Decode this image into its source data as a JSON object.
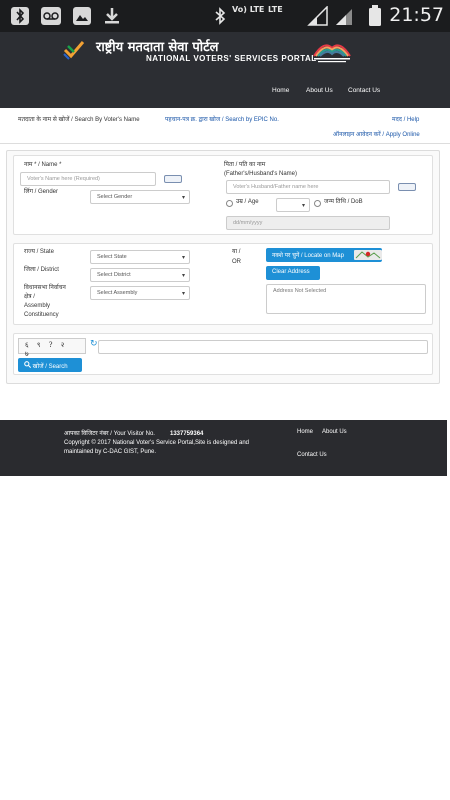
{
  "status_bar": {
    "time": "21:57",
    "network_label": "Vo) LTE",
    "lte_label": "LTE"
  },
  "header": {
    "title_hindi": "राष्ट्रीय मतदाता सेवा पोर्टल",
    "title_english": "NATIONAL VOTERS' SERVICES PORTAL",
    "nav": [
      "Home",
      "About Us",
      "Contact Us"
    ]
  },
  "mode_bar": {
    "search_by_name": "मतदाता के नाम से खोजें / Search By Voter's Name",
    "search_by_epic": "पहचान-पत्र क्र. द्वारा खोज / Search by EPIC No.",
    "help": "मदद / Help",
    "apply_online": "ऑनलाइन आवेदन करें / Apply Online"
  },
  "form": {
    "name_label": "नाम * / Name *",
    "name_placeholder": "Voter's Name here (Required)",
    "relative_label_1": "पिता / पति का नाम",
    "relative_label_2": "(Father's/Husband's Name)",
    "relative_placeholder": "Voter's Husband/Father name here",
    "gender_label": "लिंग / Gender",
    "gender_value": "Select Gender",
    "age_label": "उम्र / Age",
    "dob_label": "जन्म तिथि / DoB",
    "dob_placeholder": "dd/mm/yyyy",
    "state_label": "राज्य / State",
    "state_value": "Select State",
    "district_label": "जिला / District",
    "district_value": "Select District",
    "assembly_label_1": "विधानसभा निर्वाचन",
    "assembly_label_2": "क्षेत्र /",
    "assembly_label_3": "Assembly",
    "assembly_label_4": "Constituency",
    "assembly_value": "Select Assembly",
    "or_label_1": "या /",
    "or_label_2": "OR",
    "locate_button": "नक्शे पर चुनें / Locate on Map",
    "clear_button": "Clear Address",
    "address_placeholder": "Address Not Selected",
    "captcha_text": "६ ९ ? २ ७",
    "search_button": "खोजें / Search"
  },
  "footer": {
    "visitor_label": "आपका विजिटर नंबर / Your Visitor No.",
    "visitor_number": "1337759364",
    "copyright_1": "Copyright © 2017 National Voter's Service Portal,Site is designed and",
    "copyright_2": "maintained by C-DAC GIST, Pune.",
    "nav": [
      "Home",
      "About Us",
      "Contact Us"
    ]
  }
}
